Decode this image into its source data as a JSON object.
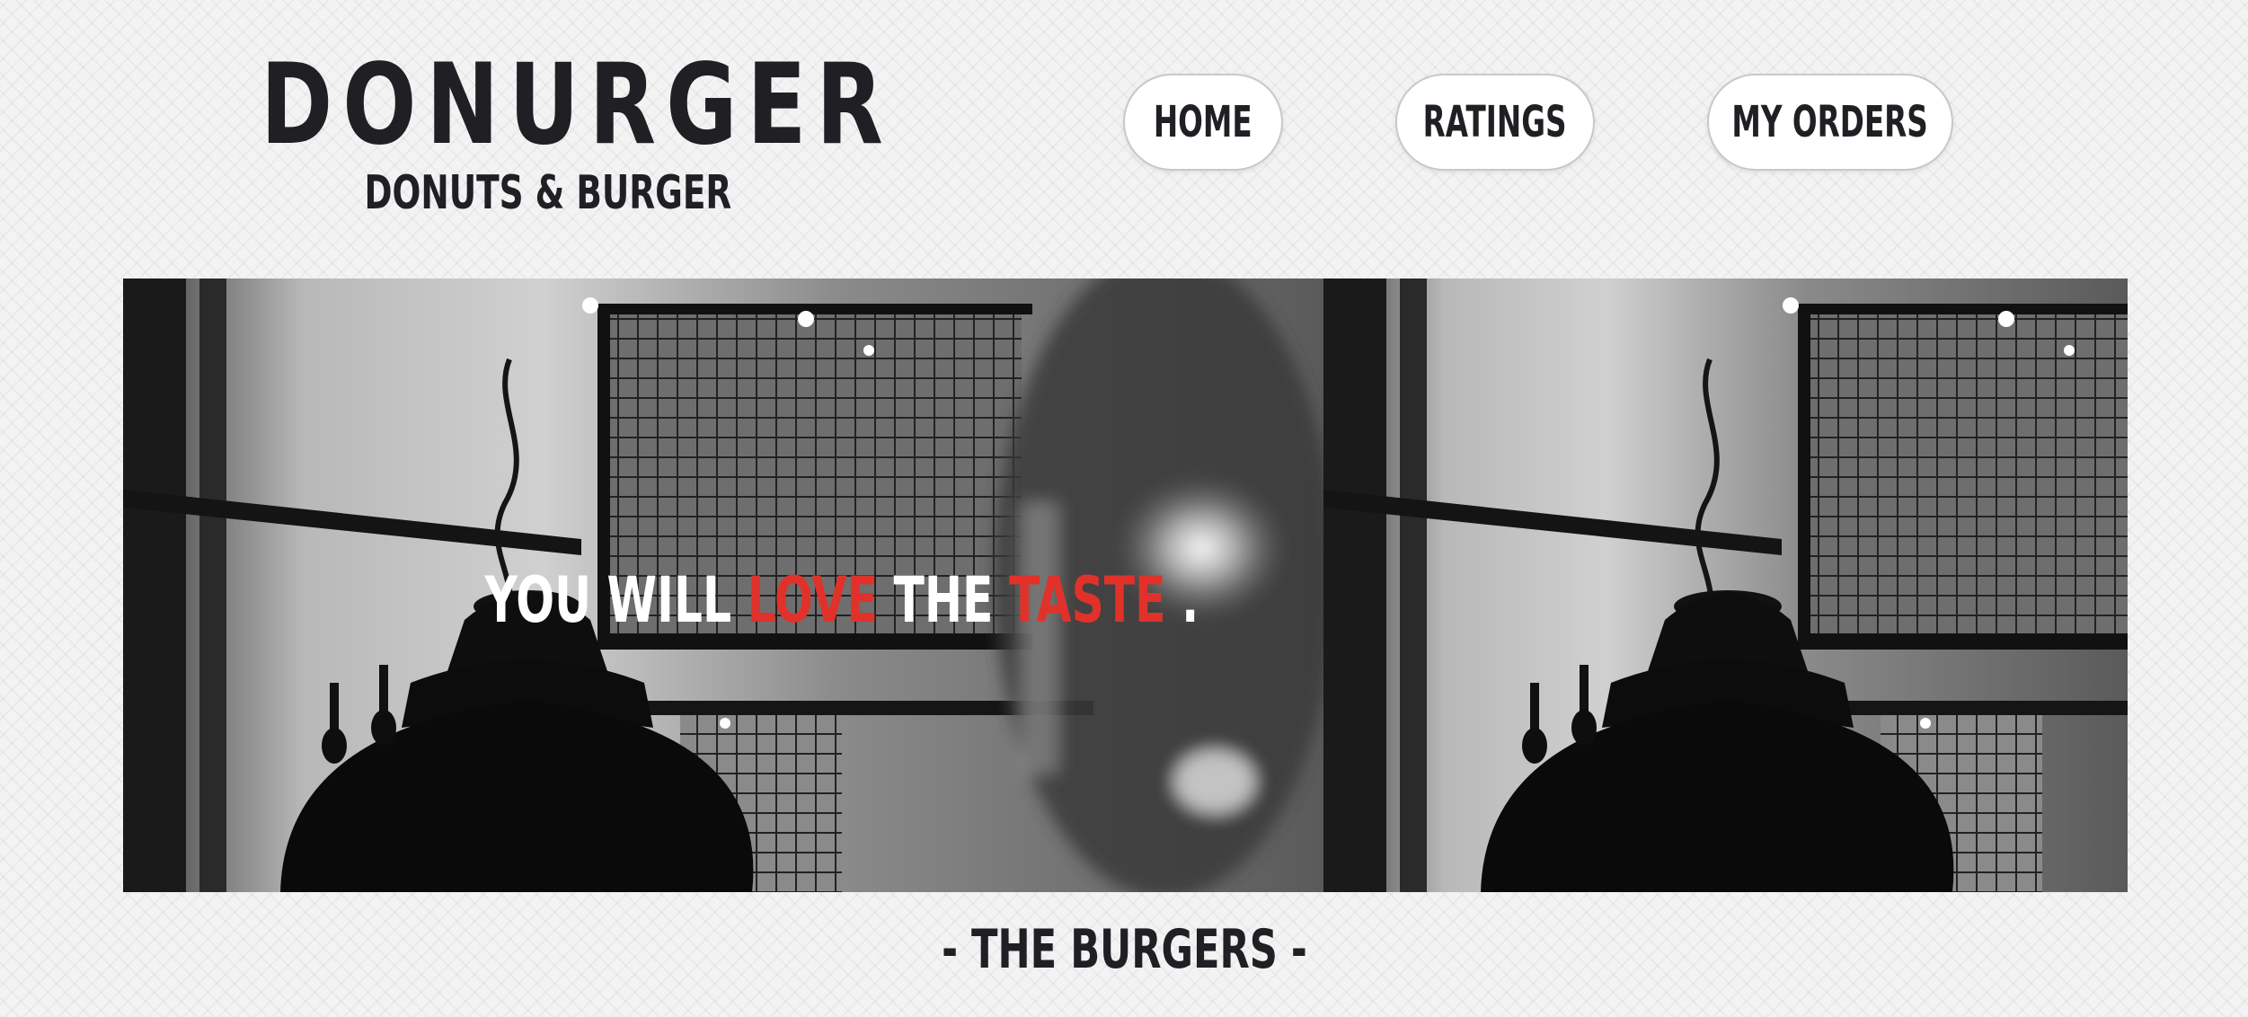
{
  "logo": {
    "title": "DONURGER",
    "subtitle": "DONUTS & BURGER"
  },
  "nav": {
    "home": "HOME",
    "ratings": "RATINGS",
    "orders": "MY ORDERS"
  },
  "hero": {
    "tagline": {
      "part1": "YOU WILL ",
      "part2": "LOVE",
      "part3": " THE ",
      "part4": "TASTE",
      "part5": " ."
    }
  },
  "section": {
    "heading": "- THE BURGERS -"
  },
  "colors": {
    "text": "#1f1f24",
    "accent_red": "#e0322a",
    "background": "#f3f3f3"
  }
}
